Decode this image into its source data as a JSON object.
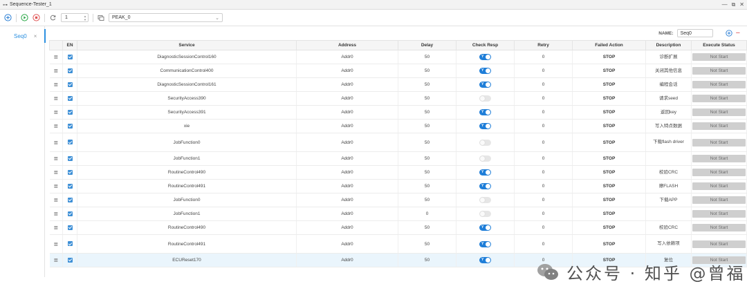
{
  "window": {
    "title": "Sequence-Tester_1"
  },
  "toolbar": {
    "repeat_value": "1",
    "channel": "PEAK_0"
  },
  "sidebar": {
    "tab_label": "Seq0",
    "close_glyph": "×"
  },
  "name_bar": {
    "label": "NAME:",
    "value": "Seq0",
    "minus_glyph": "−"
  },
  "table": {
    "columns": [
      "EN",
      "Service",
      "Address",
      "Delay",
      "Check Resp",
      "Retry",
      "Failed Action",
      "Description",
      "Execute Status"
    ],
    "rows": [
      {
        "service": "DiagnosticSessionControl160",
        "address": "Addr0",
        "delay": "50",
        "check": true,
        "retry": "0",
        "failed": "STOP",
        "desc": "诊断扩展",
        "status": "Not Start",
        "tall": false
      },
      {
        "service": "CommunicationControl400",
        "address": "Addr0",
        "delay": "50",
        "check": true,
        "retry": "0",
        "failed": "STOP",
        "desc": "关闭其他信息",
        "status": "Not Start",
        "tall": false
      },
      {
        "service": "DiagnosticSessionControl161",
        "address": "Addr0",
        "delay": "50",
        "check": true,
        "retry": "0",
        "failed": "STOP",
        "desc": "编程会话",
        "status": "Not Start",
        "tall": false
      },
      {
        "service": "SecurityAccess390",
        "address": "Addr0",
        "delay": "50",
        "check": false,
        "retry": "0",
        "failed": "STOP",
        "desc": "请求seed",
        "status": "Not Start",
        "tall": false
      },
      {
        "service": "SecurityAccess391",
        "address": "Addr0",
        "delay": "50",
        "check": true,
        "retry": "0",
        "failed": "STOP",
        "desc": "返回key",
        "status": "Not Start",
        "tall": false
      },
      {
        "service": "xie",
        "address": "Addr0",
        "delay": "50",
        "check": true,
        "retry": "0",
        "failed": "STOP",
        "desc": "写入特点数据",
        "status": "Not Start",
        "tall": false
      },
      {
        "service": "JobFunction0",
        "address": "Addr0",
        "delay": "50",
        "check": false,
        "retry": "0",
        "failed": "STOP",
        "desc": "下载flash driver",
        "status": "Not Start",
        "tall": true
      },
      {
        "service": "JobFunction1",
        "address": "Addr0",
        "delay": "50",
        "check": false,
        "retry": "0",
        "failed": "STOP",
        "desc": "",
        "status": "Not Start",
        "tall": false
      },
      {
        "service": "RoutineControl490",
        "address": "Addr0",
        "delay": "50",
        "check": true,
        "retry": "0",
        "failed": "STOP",
        "desc": "校验CRC",
        "status": "Not Start",
        "tall": false
      },
      {
        "service": "RoutineControl491",
        "address": "Addr0",
        "delay": "50",
        "check": true,
        "retry": "0",
        "failed": "STOP",
        "desc": "擦FLASH",
        "status": "Not Start",
        "tall": false
      },
      {
        "service": "JobFunction0",
        "address": "Addr0",
        "delay": "50",
        "check": false,
        "retry": "0",
        "failed": "STOP",
        "desc": "下载APP",
        "status": "Not Start",
        "tall": false
      },
      {
        "service": "JobFunction1",
        "address": "Addr0",
        "delay": "0",
        "check": false,
        "retry": "0",
        "failed": "STOP",
        "desc": "",
        "status": "Not Start",
        "tall": false
      },
      {
        "service": "RoutineControl490",
        "address": "Addr0",
        "delay": "50",
        "check": true,
        "retry": "0",
        "failed": "STOP",
        "desc": "校验CRC",
        "status": "Not Start",
        "tall": false
      },
      {
        "service": "RoutineControl491",
        "address": "Addr0",
        "delay": "50",
        "check": true,
        "retry": "0",
        "failed": "STOP",
        "desc": "写入依赖项",
        "status": "Not Start",
        "tall": true
      },
      {
        "service": "ECUReset170",
        "address": "Addr0",
        "delay": "50",
        "check": true,
        "retry": "0",
        "failed": "STOP",
        "desc": "复位",
        "status": "Not Start",
        "tall": false,
        "selected": true
      }
    ]
  },
  "watermark": {
    "text": "公众号 · 知乎 @曾福"
  },
  "colors": {
    "accent": "#1f7ed8",
    "tab": "#2b90e0",
    "status_bg": "#cfcfcf",
    "selected_row": "#eaf5fc"
  }
}
